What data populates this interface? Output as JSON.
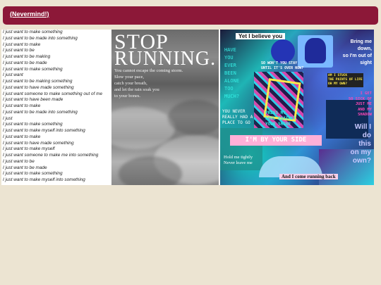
{
  "header": {
    "link_label": "(Nevermind!)"
  },
  "text_lines": [
    "I just want to make something",
    "I just want to be made into something",
    "I just want to make",
    "I just want to be",
    "I just want to be making",
    "I just want to be made",
    "I just want to make something",
    "I just want",
    "I just want to be making something",
    "I just want to have made something",
    "I just want someone to make something out of me",
    "I just want to have been made",
    "I just want to make",
    "I just want to be made into something",
    "I just",
    "I just want to make something",
    "I just want to make myself into something",
    "I just want to make",
    "I just want to have made something",
    "I just want to make myself",
    "I just want someone to make me into something",
    "I just want to be",
    "I just want to be made",
    "I just want to make something",
    "I just want to make myself into something"
  ],
  "stop_image": {
    "heading_1": "STOP",
    "heading_2": "RUNNING.",
    "body_lines": [
      "You cannot escape the coming storm.",
      "Slow your pace,",
      "catch your breath,",
      "and let the rain soak you",
      "to your bones."
    ]
  },
  "collage": {
    "yet_i_believe": "Yet I believe you",
    "bring_me_down": [
      "Bring me down,",
      "so I'm out of",
      "sight"
    ],
    "have_you_ever": [
      "HAVE",
      "YOU",
      "EVER",
      "BEEN",
      "ALONE",
      "TOO",
      "MUCH?"
    ],
    "so_wont_you_stay": [
      "SO WON'T YOU STAY",
      "UNTIL IT'S OVER NOW?"
    ],
    "am_i_stuck": [
      "AM I STUCK",
      "THE PAINTS OF LIFE",
      "OH MY OWN?"
    ],
    "i_get": [
      "I GET",
      "SO SICK OF",
      "JUST ME",
      "AND MY",
      "SHADOW"
    ],
    "you_never": [
      "YOU NEVER",
      "REALLY HAD A",
      "PLACE TO GO"
    ],
    "press_my_soul": [
      "PRESS MY",
      "SOUL AGAINST",
      "YOUR SHINE"
    ],
    "will_i_do_this": [
      "Will I",
      "do",
      "this",
      "on my",
      "own?"
    ],
    "im_by_your_side": "I'M BY YOUR SIDE",
    "hold_me_tightly": [
      "Hold me tightly",
      "Never leave me"
    ],
    "running_back": "And I come running back"
  },
  "colors": {
    "page_bg": "#ece4d2",
    "header_bar": "#8c1838",
    "neon_cyan": "#35f0e6",
    "neon_pink": "#ff47b5",
    "neon_yellow": "#ffe94a"
  }
}
